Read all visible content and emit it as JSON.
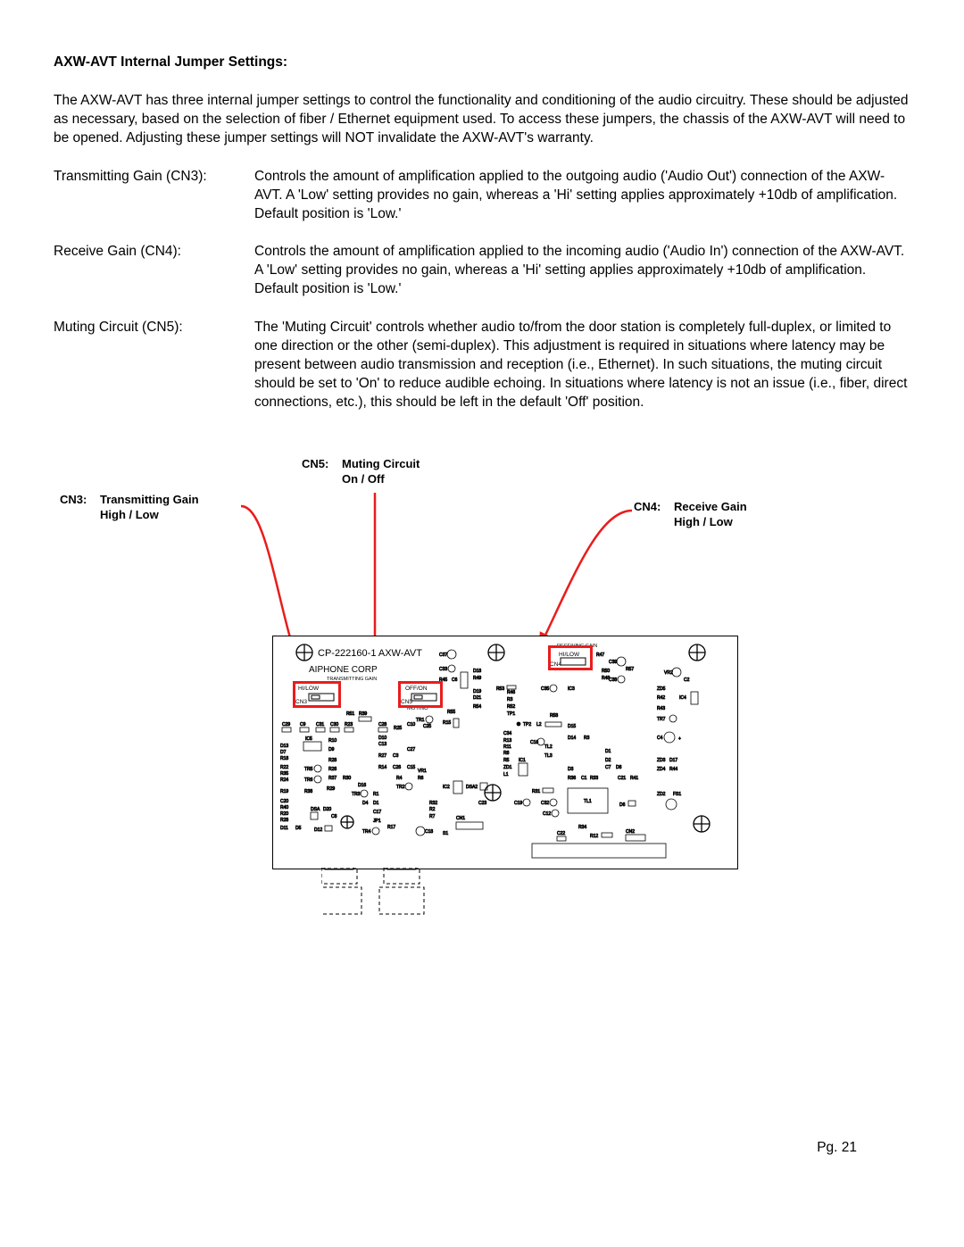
{
  "title": "AXW-AVT Internal Jumper Settings:",
  "intro": "The AXW-AVT has three internal jumper settings to control the functionality and conditioning of the audio circuitry.  These should be adjusted as necessary, based on the selection of fiber / Ethernet equipment used.  To access these jumpers, the chassis of the AXW-AVT will need to be opened.  Adjusting these jumper settings will NOT invalidate the AXW-AVT's warranty.",
  "jumpers": [
    {
      "label": "Transmitting Gain (CN3):",
      "desc": "Controls the amount of amplification applied to the outgoing audio ('Audio Out') connection of the AXW-AVT.  A 'Low' setting provides no gain, whereas a 'Hi' setting applies approximately +10db of amplification.  Default position is 'Low.'"
    },
    {
      "label": "Receive Gain (CN4):",
      "desc": "Controls the amount of amplification applied to the incoming audio ('Audio In') connection of the AXW-AVT.  A 'Low' setting provides no gain, whereas a 'Hi' setting applies approximately +10db of amplification.  Default position is 'Low.'"
    },
    {
      "label": "Muting Circuit (CN5):",
      "desc": "The 'Muting Circuit' controls whether audio to/from the door station is completely full-duplex, or limited to one direction or the other (semi-duplex).  This adjustment is required in situations where latency may be present between audio transmission and reception (i.e., Ethernet).  In such situations, the muting circuit should be set to 'On' to reduce audible echoing.  In situations where latency is not an issue (i.e., fiber, direct connections, etc.), this should be left in the default 'Off' position."
    }
  ],
  "callouts": {
    "cn3": {
      "id": "CN3:",
      "t1": "Transmitting Gain",
      "t2": "High / Low"
    },
    "cn5": {
      "id": "CN5:",
      "t1": "Muting Circuit",
      "t2": "On / Off"
    },
    "cn4": {
      "id": "CN4:",
      "t1": "Receive Gain",
      "t2": "High / Low"
    }
  },
  "board": {
    "model": "CP-222160-1  AXW-AVT",
    "vendor": "AIPHONE CORP",
    "cn3_sub": "HI/LOW",
    "cn3_lab": "CN3",
    "cn3_head": "TRANSMITTING GAIN",
    "cn5_sub": "OFF/ON",
    "cn5_lab": "CN5",
    "cn5_mut": "MUTING",
    "cn4_sub": "HI/LOW",
    "cn4_lab": "CN4",
    "cn4_head": "RECEIVING GAIN"
  },
  "page": "Pg. 21"
}
